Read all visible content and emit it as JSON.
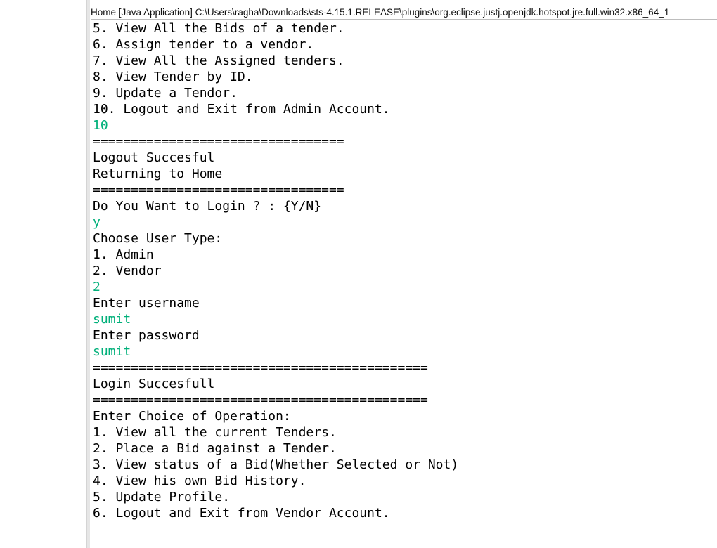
{
  "console_title": "Home [Java Application] C:\\Users\\ragha\\Downloads\\sts-4.15.1.RELEASE\\plugins\\org.eclipse.justj.openjdk.hotspot.jre.full.win32.x86_64_1",
  "input_color": "#00b07a",
  "lines": [
    {
      "text": "5. View All the Bids of a tender.",
      "type": "output"
    },
    {
      "text": "6. Assign tender to a vendor.",
      "type": "output"
    },
    {
      "text": "7. View All the Assigned tenders.",
      "type": "output"
    },
    {
      "text": "8. View Tender by ID.",
      "type": "output"
    },
    {
      "text": "9. Update a Tendor.",
      "type": "output"
    },
    {
      "text": "10. Logout and Exit from Admin Account.",
      "type": "output"
    },
    {
      "text": "10",
      "type": "input"
    },
    {
      "text": "=================================",
      "type": "output"
    },
    {
      "text": "Logout Succesful",
      "type": "output"
    },
    {
      "text": "Returning to Home",
      "type": "output"
    },
    {
      "text": "=================================",
      "type": "output"
    },
    {
      "text": "Do You Want to Login ? : {Y/N}",
      "type": "output"
    },
    {
      "text": "y",
      "type": "input"
    },
    {
      "text": "Choose User Type:",
      "type": "output"
    },
    {
      "text": "1. Admin",
      "type": "output"
    },
    {
      "text": "2. Vendor",
      "type": "output"
    },
    {
      "text": "2",
      "type": "input"
    },
    {
      "text": "Enter username",
      "type": "output"
    },
    {
      "text": "sumit",
      "type": "input"
    },
    {
      "text": "Enter password",
      "type": "output"
    },
    {
      "text": "sumit",
      "type": "input"
    },
    {
      "text": "============================================",
      "type": "output"
    },
    {
      "text": "Login Succesfull",
      "type": "output"
    },
    {
      "text": "============================================",
      "type": "output"
    },
    {
      "text": "Enter Choice of Operation:",
      "type": "output"
    },
    {
      "text": "1. View all the current Tenders.",
      "type": "output"
    },
    {
      "text": "2. Place a Bid against a Tender.",
      "type": "output"
    },
    {
      "text": "3. View status of a Bid(Whether Selected or Not)",
      "type": "output"
    },
    {
      "text": "4. View his own Bid History.",
      "type": "output"
    },
    {
      "text": "5. Update Profile.",
      "type": "output"
    },
    {
      "text": "6. Logout and Exit from Vendor Account.",
      "type": "output"
    }
  ]
}
